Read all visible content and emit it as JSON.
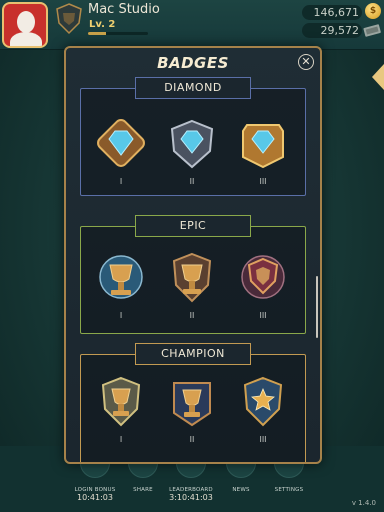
{
  "player": {
    "name": "Mac Studio",
    "level": "Lv. 2",
    "xp_progress": 0.3
  },
  "currency": {
    "coins": "146,671",
    "cash": "29,572",
    "coin_symbol": "$"
  },
  "modal": {
    "title": "BADGES",
    "close_symbol": "✕",
    "sections": [
      {
        "label": "DIAMOND",
        "border_color": "#5a6fa8",
        "tiers": [
          "I",
          "II",
          "III"
        ]
      },
      {
        "label": "EPIC",
        "border_color": "#8aa84a",
        "tiers": [
          "I",
          "II",
          "III"
        ]
      },
      {
        "label": "CHAMPION",
        "border_color": "#c29a52",
        "tiers": [
          "I",
          "II",
          "III"
        ]
      }
    ]
  },
  "nav": [
    {
      "label": "LOGIN BONUS",
      "time": "10:41:03",
      "icon": "gift-icon"
    },
    {
      "label": "SHARE",
      "time": "",
      "icon": "share-icon"
    },
    {
      "label": "LEADERBOARD",
      "time": "3:10:41:03",
      "icon": "trophy-icon"
    },
    {
      "label": "NEWS",
      "time": "",
      "icon": "news-icon"
    },
    {
      "label": "SETTINGS",
      "time": "",
      "icon": "gear-icon"
    }
  ],
  "version": "v 1.4.0",
  "colors": {
    "accent_gold": "#c9a24a",
    "diamond": "#5a6fa8",
    "epic": "#8aa84a",
    "champion": "#c29a52"
  }
}
